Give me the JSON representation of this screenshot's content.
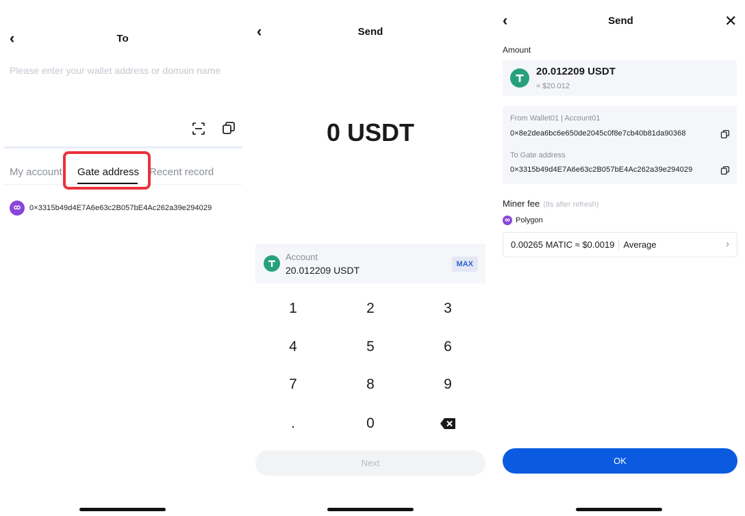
{
  "panel1": {
    "back_icon": "‹",
    "title": "To",
    "placeholder": "Please enter your wallet address or domain name",
    "scan_icon": "scan-icon",
    "paste_icon": "copy-icon",
    "tabs": [
      "My account",
      "Gate address",
      "Recent record"
    ],
    "active_tab": "Gate address",
    "highlight_color": "#e9323c",
    "address_rows": [
      {
        "network_icon": "polygon-icon",
        "address": "0×3315b49d4E7A6e63c2B057bE4Ac262a39e294029"
      }
    ]
  },
  "panel2": {
    "back_icon": "‹",
    "title": "Send",
    "amount_display": "0 USDT",
    "account_label": "Account",
    "account_balance": "20.012209 USDT",
    "max_label": "MAX",
    "keypad": [
      "1",
      "2",
      "3",
      "4",
      "5",
      "6",
      "7",
      "8",
      "9",
      ".",
      "0",
      "backspace"
    ],
    "next_label": "Next"
  },
  "panel3": {
    "back_icon": "‹",
    "title": "Send",
    "close_icon": "✕",
    "amount_label": "Amount",
    "amount_value": "20.012209 USDT",
    "amount_fiat": "≈ $20.012",
    "from_label": "From Wallet01 | Account01",
    "from_address": "0×8e2dea6bc6e650de2045c0f8e7cb40b81da90368",
    "to_label": "To Gate address",
    "to_address": "0×3315b49d4E7A6e63c2B057bE4Ac262a39e294029",
    "fee_label": "Miner fee",
    "fee_note": "(8s after refresh)",
    "network": "Polygon",
    "fee_value": "0.00265 MATIC ≈ $0.0019",
    "fee_speed": "Average",
    "ok_label": "OK",
    "accent_color": "#0a5bdf"
  },
  "colors": {
    "tether_green": "#26a17b",
    "polygon_purple": "#8a46d9"
  }
}
